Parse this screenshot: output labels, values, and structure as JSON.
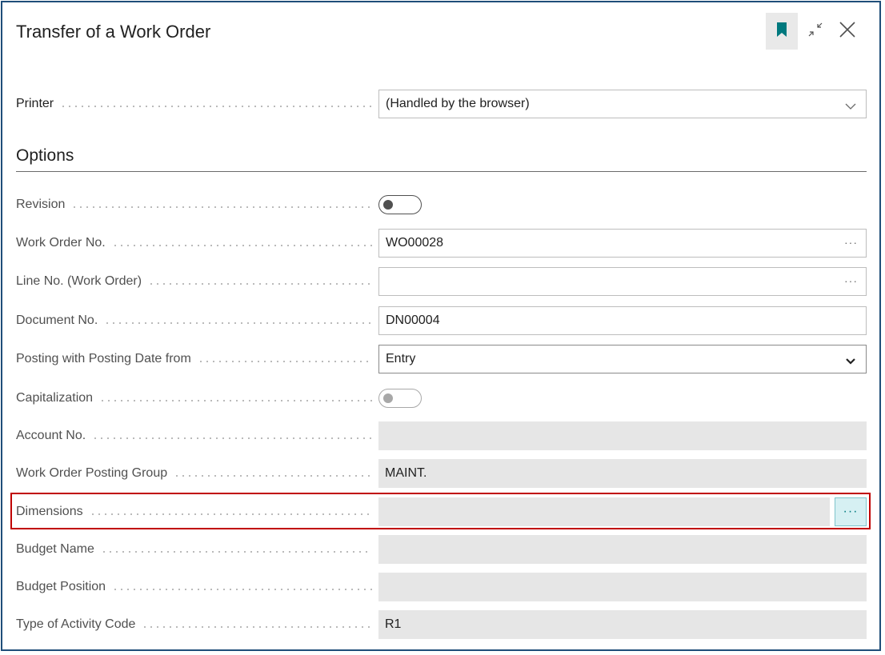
{
  "dialog": {
    "title": "Transfer of a Work Order"
  },
  "printer": {
    "label": "Printer",
    "value": "(Handled by the browser)"
  },
  "options": {
    "section_title": "Options",
    "revision": {
      "label": "Revision",
      "checked": false
    },
    "work_order_no": {
      "label": "Work Order No.",
      "value": "WO00028",
      "assist": "···"
    },
    "line_no": {
      "label": "Line No. (Work Order)",
      "value": "",
      "assist": "···"
    },
    "document_no": {
      "label": "Document No.",
      "value": "DN00004"
    },
    "posting_date_from": {
      "label": "Posting with Posting Date from",
      "value": "Entry"
    },
    "capitalization": {
      "label": "Capitalization",
      "checked": false,
      "disabled": true
    },
    "account_no": {
      "label": "Account No.",
      "value": ""
    },
    "posting_group": {
      "label": "Work Order Posting Group",
      "value": "MAINT."
    },
    "dimensions": {
      "label": "Dimensions",
      "value": "",
      "assist": "···"
    },
    "budget_name": {
      "label": "Budget Name",
      "value": ""
    },
    "budget_position": {
      "label": "Budget Position",
      "value": ""
    },
    "activity_code": {
      "label": "Type of Activity Code",
      "value": "R1"
    }
  },
  "colors": {
    "frame": "#1f4e79",
    "highlight": "#c00000",
    "accent": "#00797e",
    "readonly_bg": "#e6e6e6"
  },
  "icons": [
    "bookmark-icon",
    "collapse-icon",
    "close-icon",
    "chevron-down-icon",
    "ellipsis-icon"
  ]
}
